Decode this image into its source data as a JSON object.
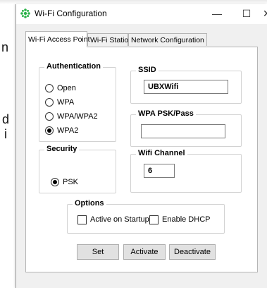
{
  "background": {
    "fragments": [
      "n",
      "d",
      "i"
    ]
  },
  "window": {
    "title": "Wi-Fi Configuration",
    "minimize_glyph": "—",
    "maximize_glyph": "☐",
    "close_glyph": "✕",
    "accent_color": "#2db34a"
  },
  "tabs": [
    {
      "label": "Wi-Fi Access Point",
      "active": true
    },
    {
      "label": "Wi-Fi Station",
      "active": false
    },
    {
      "label": "Network Configuration",
      "active": false
    }
  ],
  "authentication": {
    "title": "Authentication",
    "options": [
      {
        "label": "Open",
        "checked": false
      },
      {
        "label": "WPA",
        "checked": false
      },
      {
        "label": "WPA/WPA2",
        "checked": false
      },
      {
        "label": "WPA2",
        "checked": true
      }
    ]
  },
  "ssid": {
    "title": "SSID",
    "value": "UBXWifi"
  },
  "wpa_psk": {
    "title": "WPA PSK/Pass",
    "value": ""
  },
  "security": {
    "title": "Security",
    "options": [
      {
        "label": "PSK",
        "checked": true
      }
    ]
  },
  "wifi_channel": {
    "title": "Wifi Channel",
    "value": "6"
  },
  "options": {
    "title": "Options",
    "active_on_startup": {
      "label": "Active on Startup",
      "checked": false
    },
    "enable_dhcp": {
      "label": "Enable DHCP",
      "checked": false
    }
  },
  "buttons": {
    "set": "Set",
    "activate": "Activate",
    "deactivate": "Deactivate"
  }
}
